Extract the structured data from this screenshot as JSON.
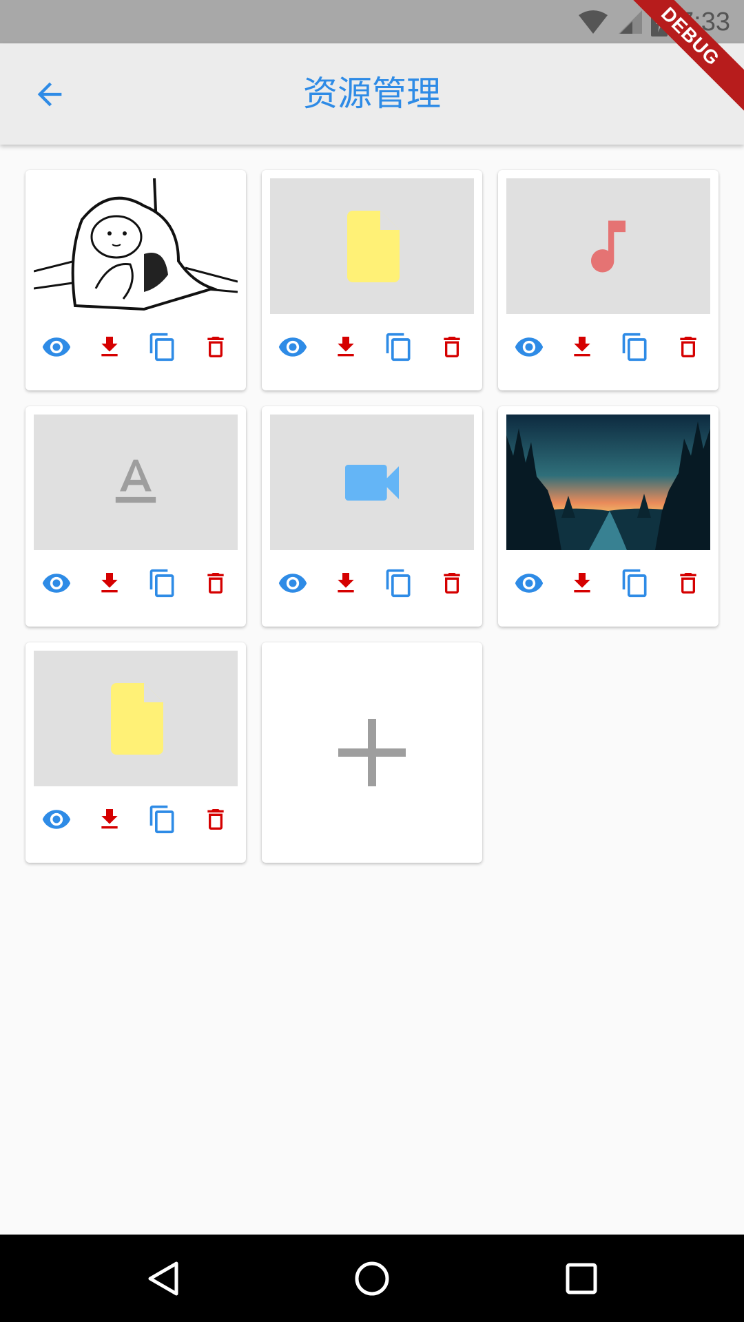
{
  "status_bar": {
    "time": "7:33",
    "icons": [
      "wifi-icon",
      "cellular-signal-icon",
      "battery-charging-icon"
    ]
  },
  "debug_banner": "DEBUG",
  "app_bar": {
    "title": "资源管理",
    "back_icon": "arrow-back-icon"
  },
  "resources": [
    {
      "kind": "image",
      "thumbnail": "sketch-character-under-blanket"
    },
    {
      "kind": "file",
      "icon": "file-icon",
      "color": "#fff176"
    },
    {
      "kind": "audio",
      "icon": "music-note-icon",
      "color": "#e57373"
    },
    {
      "kind": "font",
      "icon": "text-format-icon",
      "color": "#9e9e9e"
    },
    {
      "kind": "video",
      "icon": "videocam-icon",
      "color": "#64b5f6"
    },
    {
      "kind": "image",
      "thumbnail": "forest-river-sunset"
    },
    {
      "kind": "file",
      "icon": "file-icon",
      "color": "#fff176"
    }
  ],
  "card_actions": [
    "preview-eye-icon",
    "download-icon",
    "copy-icon",
    "delete-icon"
  ],
  "colors": {
    "accent_blue": "#2e8be6",
    "action_red": "#d50000",
    "app_bar": "#ececec",
    "status_bar": "#a8a8a8"
  },
  "add_icon": "add-icon",
  "nav_bar": [
    "nav-back-icon",
    "nav-home-icon",
    "nav-recents-icon"
  ]
}
